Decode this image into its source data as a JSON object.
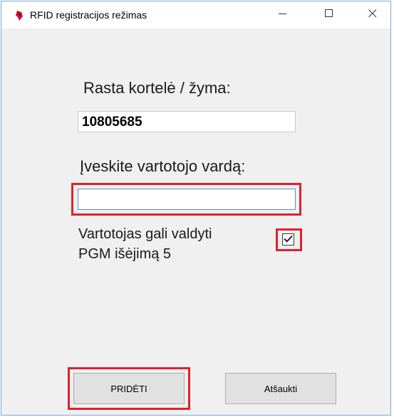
{
  "window": {
    "title": "RFID registracijos režimas",
    "icon": "rfid-app-icon",
    "controls": {
      "minimize_icon": "minimize-icon",
      "maximize_icon": "maximize-icon",
      "close_icon": "close-icon"
    }
  },
  "card": {
    "label": "Rasta kortelė / žyma:",
    "value": "10805685"
  },
  "user": {
    "label": "Įveskite vartotojo vardą:",
    "value": "",
    "placeholder": ""
  },
  "pgm": {
    "label_line1": "Vartotojas gali valdyti",
    "label_line2": "PGM išėjimą 5",
    "checked": true
  },
  "buttons": {
    "add_label": "PRIDĖTI",
    "cancel_label": "Atšaukti"
  },
  "colors": {
    "highlight": "#e0202c",
    "window_border": "#7aa7dd",
    "input_focus_border": "#5b8fd6",
    "app_icon": "#c8102e"
  }
}
